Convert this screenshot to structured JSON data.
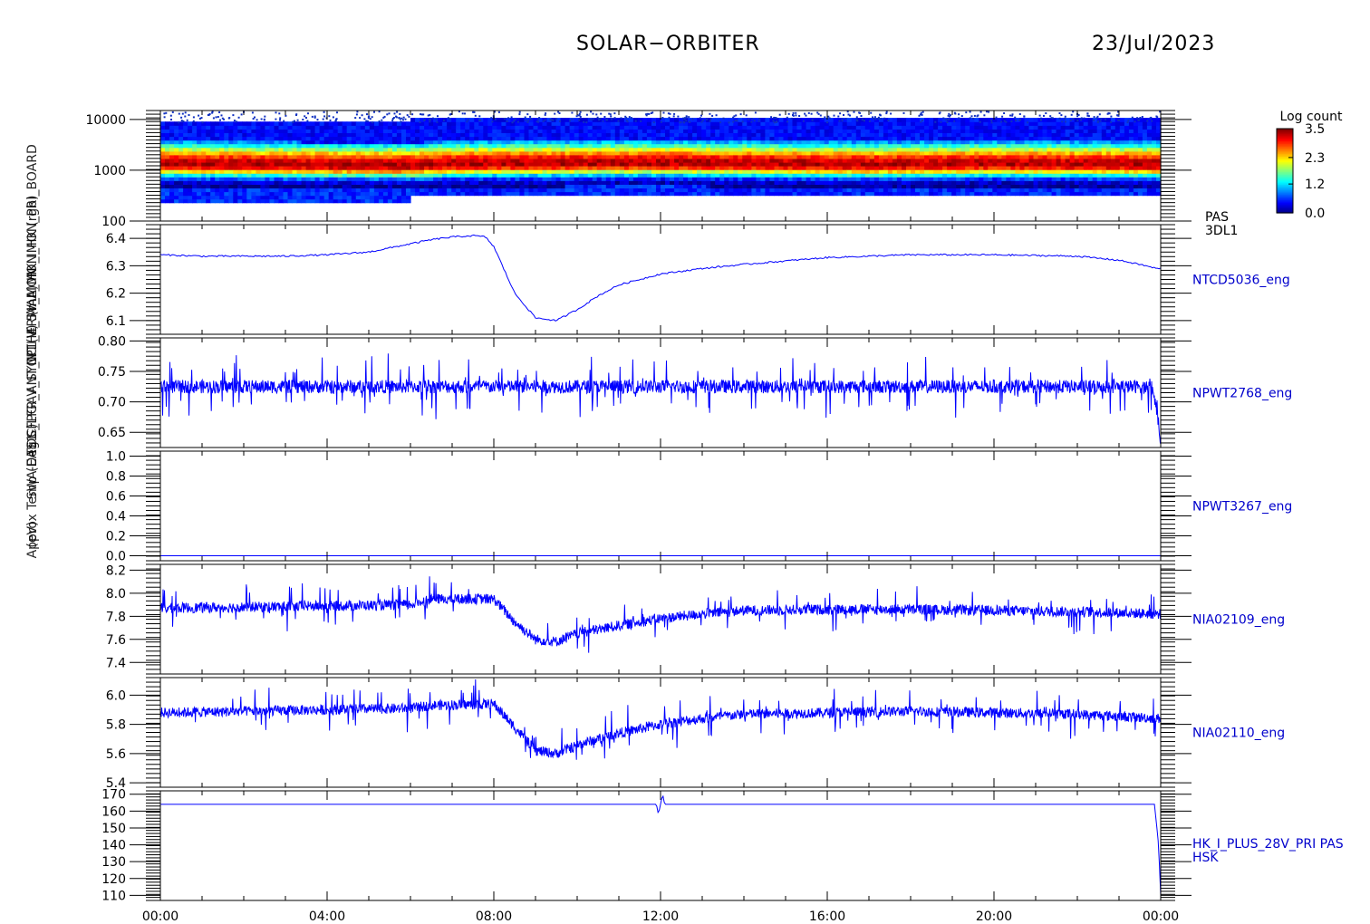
{
  "header": {
    "title": "SOLAR−ORBITER",
    "date": "23/Jul/2023"
  },
  "x_axis": {
    "range": [
      0,
      24
    ],
    "tick_labels": [
      "00:00",
      "04:00",
      "08:00",
      "12:00",
      "16:00",
      "20:00",
      "00:00"
    ]
  },
  "colorbar": {
    "title": "Log count",
    "range": [
      0.0,
      3.5
    ],
    "tick_labels": [
      "3.5",
      "2.3",
      "1.2",
      "0.0"
    ],
    "tick_values": [
      3.5,
      2.3,
      1.2,
      0.0
    ]
  },
  "y_axis_labels": [
    "(eV)",
    "Approx Temp (Deg C)",
    "SWA-EAS1-FPGA",
    "TDS_LFR_ANT_N",
    "V_SYNC (V)",
    "CP1_4_5V_MON",
    "THERMAL_MON_HK (rgb)",
    "(mA) HK_IMON_PRI_BOARD"
  ],
  "chart_data": [
    {
      "type": "heatmap",
      "ylabel": "(eV)",
      "scale": "log",
      "ylim": [
        100,
        15000
      ],
      "y_tick_labels": [
        "10000",
        "1000",
        "100"
      ],
      "y_tick_values": [
        10000,
        1000,
        100
      ],
      "right_label": [
        "PAS",
        "3DL1"
      ],
      "peak_energy_eV": {
        "x": [
          0,
          2.5,
          6,
          7,
          12,
          17,
          20,
          23.8
        ],
        "y": [
          1350,
          1300,
          1250,
          1350,
          1400,
          1300,
          1350,
          1300
        ]
      }
    },
    {
      "type": "line",
      "right_label": "NTCD5036_eng",
      "ylim": [
        6.05,
        6.45
      ],
      "y_tick_labels": [
        "6.4",
        "6.3",
        "6.2",
        "6.1"
      ],
      "y_tick_values": [
        6.4,
        6.3,
        6.2,
        6.1
      ],
      "x": [
        0,
        1,
        2,
        3,
        4,
        5,
        6,
        6.5,
        7,
        7.5,
        7.8,
        8,
        8.5,
        9,
        9.5,
        10,
        10.5,
        11,
        12,
        13,
        14,
        16,
        18,
        20,
        22,
        23,
        23.5,
        23.9
      ],
      "y": [
        6.34,
        6.335,
        6.335,
        6.335,
        6.34,
        6.35,
        6.38,
        6.395,
        6.405,
        6.41,
        6.405,
        6.37,
        6.2,
        6.11,
        6.1,
        6.14,
        6.19,
        6.23,
        6.27,
        6.29,
        6.305,
        6.33,
        6.34,
        6.34,
        6.335,
        6.32,
        6.305,
        6.29
      ]
    },
    {
      "type": "line",
      "right_label": "NPWT2768_eng",
      "ylim": [
        0.625,
        0.805
      ],
      "y_tick_labels": [
        "0.80",
        "0.75",
        "0.70",
        "0.65"
      ],
      "y_tick_values": [
        0.8,
        0.75,
        0.7,
        0.65
      ],
      "noise": [
        0.72,
        0.74
      ],
      "spike_range": [
        0.7,
        0.79
      ],
      "x": [
        0,
        23.7,
        23.8,
        23.9,
        24
      ],
      "y": [
        0.725,
        0.725,
        0.72,
        0.69,
        0.635
      ]
    },
    {
      "type": "line",
      "right_label": "NPWT3267_eng",
      "ylim": [
        -0.05,
        1.05
      ],
      "y_tick_labels": [
        "1.0",
        "0.8",
        "0.6",
        "0.4",
        "0.2",
        "0.0"
      ],
      "y_tick_values": [
        1.0,
        0.8,
        0.6,
        0.4,
        0.2,
        0.0
      ],
      "x": [
        0,
        24
      ],
      "y": [
        0.0,
        0.0
      ]
    },
    {
      "type": "line",
      "right_label": "NIA02109_eng",
      "ylim": [
        7.3,
        8.25
      ],
      "y_tick_labels": [
        "8.2",
        "8.0",
        "7.8",
        "7.6",
        "7.4"
      ],
      "y_tick_values": [
        8.2,
        8.0,
        7.8,
        7.6,
        7.4
      ],
      "x": [
        0,
        6,
        6.5,
        8,
        8.5,
        9,
        9.5,
        10,
        11,
        12,
        13,
        14,
        16,
        18,
        20,
        22,
        24
      ],
      "y": [
        7.87,
        7.9,
        7.95,
        7.95,
        7.75,
        7.6,
        7.58,
        7.65,
        7.72,
        7.78,
        7.82,
        7.85,
        7.86,
        7.86,
        7.85,
        7.84,
        7.82
      ]
    },
    {
      "type": "line",
      "right_label": "NIA02110_eng",
      "ylim": [
        5.37,
        6.12
      ],
      "y_tick_labels": [
        "6.0",
        "5.8",
        "5.6",
        "5.4"
      ],
      "y_tick_values": [
        6.0,
        5.8,
        5.6,
        5.4
      ],
      "x": [
        0,
        6,
        6.5,
        8,
        8.5,
        9,
        9.5,
        10,
        11,
        12,
        13,
        14,
        16,
        18,
        20,
        22,
        24
      ],
      "y": [
        5.88,
        5.91,
        5.93,
        5.94,
        5.78,
        5.62,
        5.6,
        5.66,
        5.74,
        5.8,
        5.84,
        5.87,
        5.88,
        5.89,
        5.88,
        5.87,
        5.84
      ]
    },
    {
      "type": "line",
      "right_label": [
        "HK_I_PLUS_28V_PRI PAS",
        "HSK"
      ],
      "ylim": [
        107,
        172
      ],
      "y_tick_labels": [
        "170",
        "160",
        "150",
        "140",
        "130",
        "120",
        "110"
      ],
      "y_tick_values": [
        170,
        160,
        150,
        140,
        130,
        120,
        110
      ],
      "x": [
        0,
        11.9,
        11.95,
        12.05,
        12.1,
        23.85,
        23.95,
        24
      ],
      "y": [
        164,
        164,
        158,
        170,
        164,
        164,
        140,
        110
      ]
    }
  ]
}
